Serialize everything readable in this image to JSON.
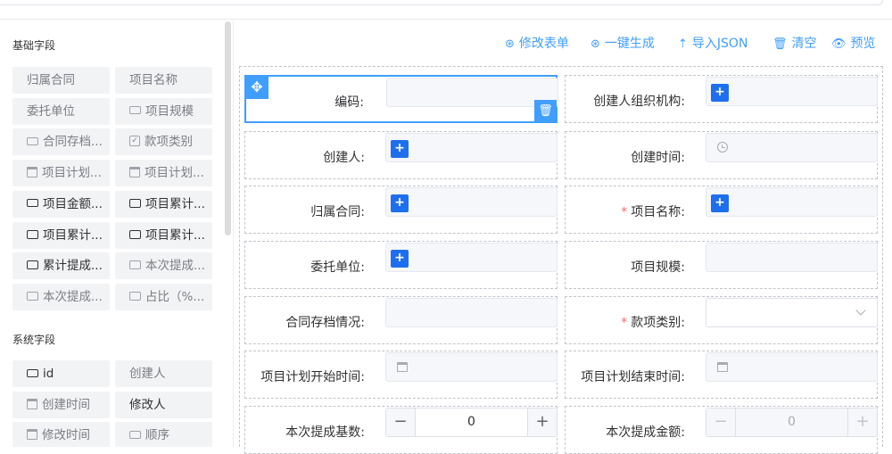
{
  "sidebar": {
    "basic_title": "基础字段",
    "basic_items": [
      {
        "label": "归属合同",
        "icon": "",
        "dark": false
      },
      {
        "label": "项目名称",
        "icon": "",
        "dark": false
      },
      {
        "label": "委托单位",
        "icon": "",
        "dark": false
      },
      {
        "label": "项目规模",
        "icon": "input-icon",
        "dark": false
      },
      {
        "label": "合同存档...",
        "icon": "input-icon",
        "dark": false
      },
      {
        "label": "款项类别",
        "icon": "checkbox-icon",
        "dark": false
      },
      {
        "label": "项目计划...",
        "icon": "date-icon",
        "dark": false
      },
      {
        "label": "项目计划...",
        "icon": "date-icon",
        "dark": false
      },
      {
        "label": "项目金额...",
        "icon": "input-icon",
        "dark": true
      },
      {
        "label": "项目累计...",
        "icon": "textarea-icon",
        "dark": true
      },
      {
        "label": "项目累计...",
        "icon": "textarea-icon",
        "dark": true
      },
      {
        "label": "项目累计...",
        "icon": "textarea-icon",
        "dark": true
      },
      {
        "label": "累计提成...",
        "icon": "textarea-icon",
        "dark": true
      },
      {
        "label": "本次提成...",
        "icon": "textarea-icon",
        "dark": false
      },
      {
        "label": "本次提成...",
        "icon": "textarea-icon",
        "dark": false
      },
      {
        "label": "占比（%...",
        "icon": "textarea-icon",
        "dark": false
      }
    ],
    "system_title": "系统字段",
    "system_items": [
      {
        "label": "id",
        "icon": "input-icon",
        "dark": true
      },
      {
        "label": "创建人",
        "icon": "",
        "dark": false
      },
      {
        "label": "创建时间",
        "icon": "date-icon",
        "dark": false
      },
      {
        "label": "修改人",
        "icon": "",
        "dark": true
      },
      {
        "label": "修改时间",
        "icon": "date-icon",
        "dark": false
      },
      {
        "label": "顺序",
        "icon": "input-icon",
        "dark": false
      }
    ]
  },
  "toolbar": {
    "edit_form": "修改表单",
    "one_click": "一键生成",
    "import_json": "导入JSON",
    "clear": "清空",
    "preview": "预览"
  },
  "form": {
    "code_label": "编码:",
    "creator_org_label": "创建人组织机构:",
    "creator_label": "创建人:",
    "create_time_label": "创建时间:",
    "contract_label": "归属合同:",
    "project_name_label": "项目名称:",
    "client_label": "委托单位:",
    "scale_label": "项目规模:",
    "archive_label": "合同存档情况:",
    "payment_type_label": "款项类别:",
    "plan_start_label": "项目计划开始时间:",
    "plan_end_label": "项目计划结束时间:",
    "commission_base_label": "本次提成基数:",
    "commission_amount_label": "本次提成金额:",
    "commission_base_value": "0",
    "commission_amount_value": "0",
    "required_mark": "*"
  },
  "colors": {
    "accent": "#409eff",
    "button_blue": "#1e6ff0",
    "required": "#f56c6c"
  }
}
